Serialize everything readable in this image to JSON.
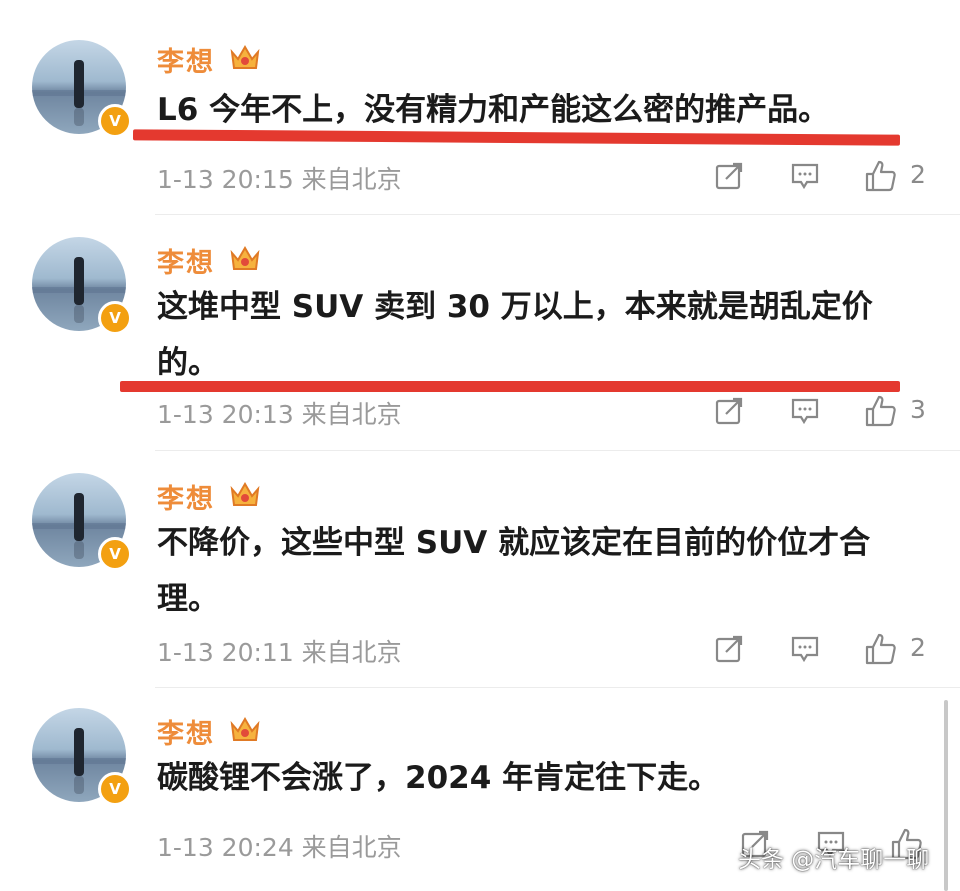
{
  "comments": [
    {
      "author": "李想",
      "text": "L6 今年不上，没有精力和产能这么密的推产品。",
      "time": "1-13 20:15 来自北京",
      "likes": "2",
      "underlined": true
    },
    {
      "author": "李想",
      "text": "这堆中型 SUV 卖到 30 万以上，本来就是胡乱定价的。",
      "time": "1-13 20:13 来自北京",
      "likes": "3",
      "underlined": true
    },
    {
      "author": "李想",
      "text": "不降价，这些中型 SUV 就应该定在目前的价位才合理。",
      "time": "1-13 20:11 来自北京",
      "likes": "2",
      "underlined": false
    },
    {
      "author": "李想",
      "text": "碳酸锂不会涨了，2024 年肯定往下走。",
      "time": "1-13 20:24 来自北京",
      "likes": "",
      "underlined": false
    }
  ],
  "badge_letter": "V",
  "watermark": "头条 @汽车聊一聊",
  "icons": {
    "avatar_badge": "verified-badge-icon",
    "crown": "crown-icon",
    "share": "share-icon",
    "reply": "comment-icon",
    "like": "thumbs-up-icon"
  },
  "colors": {
    "author": "#ee8c3a",
    "highlight_underline": "#e4392f",
    "badge": "#f3a011",
    "meta": "#9a9a9a"
  }
}
